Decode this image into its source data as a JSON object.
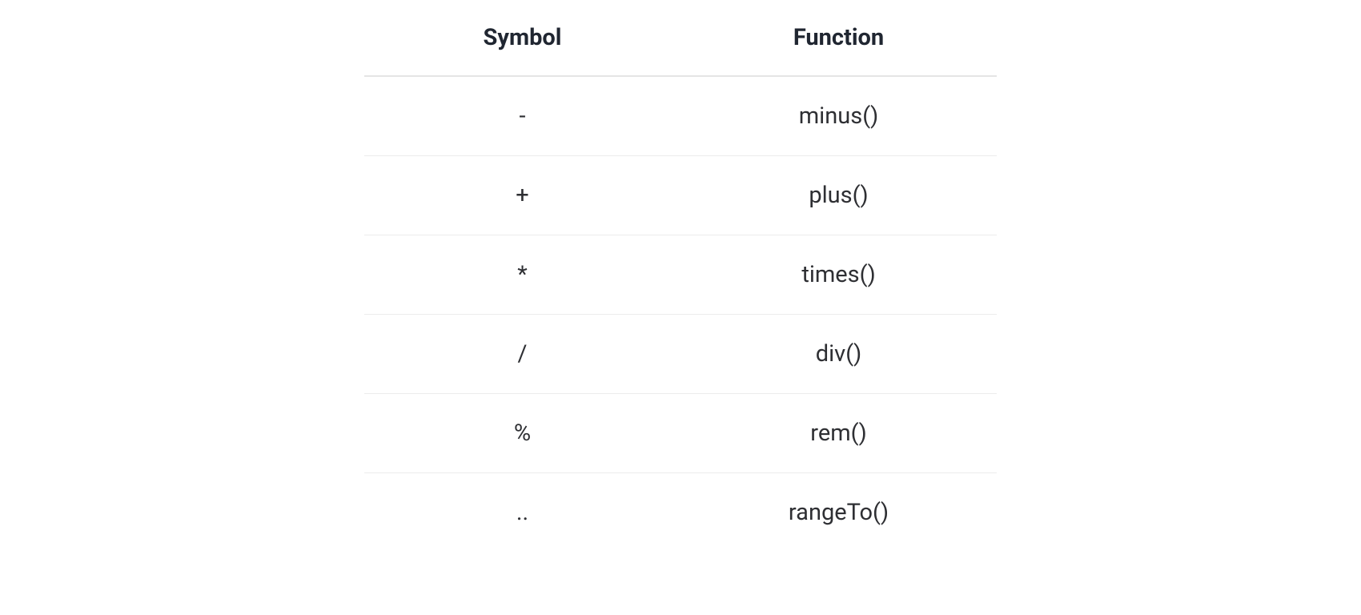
{
  "table": {
    "headers": {
      "symbol": "Symbol",
      "function": "Function"
    },
    "rows": [
      {
        "symbol": "-",
        "function": "minus()"
      },
      {
        "symbol": "+",
        "function": "plus()"
      },
      {
        "symbol": "*",
        "function": "times()"
      },
      {
        "symbol": "/",
        "function": "div()"
      },
      {
        "symbol": "%",
        "function": "rem()"
      },
      {
        "symbol": "..",
        "function": "rangeTo()"
      }
    ]
  }
}
